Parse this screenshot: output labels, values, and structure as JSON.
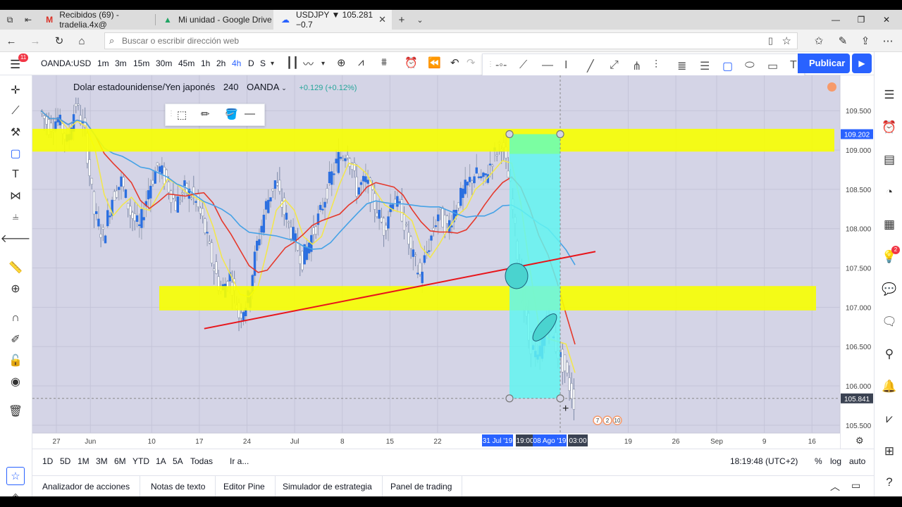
{
  "browser": {
    "tabs": [
      {
        "label": "Recibidos (69) - tradelia.4x@",
        "icon": "gmail-icon"
      },
      {
        "label": "Mi unidad - Google Drive",
        "icon": "drive-icon"
      },
      {
        "label": "USDJPY ▼ 105.281 −0.7",
        "icon": "tradingview-icon"
      }
    ],
    "address_placeholder": "Buscar o escribir dirección web"
  },
  "toolbar": {
    "symbol": "OANDA:USD",
    "intervals": [
      "1m",
      "3m",
      "15m",
      "30m",
      "45m",
      "1h",
      "2h",
      "4h",
      "D",
      "S"
    ],
    "selected_interval": "4h",
    "publish_label": "Publicar",
    "notifications": "11"
  },
  "legend": {
    "name": "Dolar estadounidense/Yen japonés",
    "interval": "240",
    "source": "OANDA",
    "change": "+0.129 (+0.12%)"
  },
  "colors": {
    "accent": "#2962ff",
    "zone": "#f7ff00",
    "range_fill": "#61f4f0",
    "range_green": "#7bff9c",
    "trendline": "#e8141a",
    "candle": "#2b6fe0",
    "ma_red": "#e5392c",
    "ma_yellow": "#f2e64f",
    "ma_blue": "#45a2e6"
  },
  "price_axis": {
    "ticks": [
      "109.500",
      "109.000",
      "108.500",
      "108.000",
      "107.500",
      "107.000",
      "106.500",
      "106.000",
      "105.500"
    ],
    "marker_upper": "109.202",
    "marker_current": "105.841"
  },
  "time_axis": {
    "ticks": [
      "27",
      "Jun",
      "10",
      "17",
      "24",
      "Jul",
      "8",
      "15",
      "22",
      "19",
      "26",
      "Sep",
      "9",
      "16"
    ],
    "highlights": [
      "31 Jul '19",
      "19:00",
      "08 Ago '19",
      "03:00"
    ]
  },
  "range_buttons": [
    "1D",
    "5D",
    "1M",
    "3M",
    "6M",
    "YTD",
    "1A",
    "5A",
    "Todas"
  ],
  "goto_label": "Ir a...",
  "clock": "18:19:48 (UTC+2)",
  "scale_options": [
    "%",
    "log",
    "auto"
  ],
  "bottom_tabs": [
    "Analizador de acciones",
    "Notas de texto",
    "Editor Pine",
    "Simulador de estrategia",
    "Panel de trading"
  ],
  "event_labels": [
    "7",
    "2",
    "10"
  ],
  "right_badge": "2",
  "chart_data": {
    "type": "candlestick",
    "title": "Dolar estadounidense/Yen japonés",
    "ylim": [
      105.4,
      109.95
    ],
    "zones": [
      {
        "low": 108.98,
        "high": 109.27
      },
      {
        "low": 106.96,
        "high": 107.27
      }
    ],
    "trendline": {
      "start": [
        24,
        106.8
      ],
      "end": [
        40.5,
        107.78
      ]
    },
    "measure_box": {
      "from_price": 109.202,
      "to_price": 105.841
    },
    "closes": [
      109.5,
      109.3,
      109.4,
      109.1,
      109.6,
      109.2,
      108.2,
      107.9,
      108.4,
      108.6,
      108.2,
      108.0,
      108.5,
      108.8,
      108.6,
      108.3,
      108.5,
      108.4,
      108.1,
      107.6,
      107.2,
      107.4,
      106.9,
      107.1,
      107.8,
      108.3,
      108.6,
      108.2,
      107.9,
      107.6,
      107.9,
      108.2,
      108.6,
      108.9,
      109.0,
      108.5,
      108.6,
      108.3,
      108.0,
      108.4,
      108.2,
      107.7,
      107.4,
      107.8,
      108.2,
      108.0,
      108.3,
      108.5,
      108.7,
      108.6,
      108.9,
      109.1,
      108.5,
      107.4,
      106.6,
      106.3,
      106.9,
      106.5,
      106.2,
      105.8
    ]
  }
}
